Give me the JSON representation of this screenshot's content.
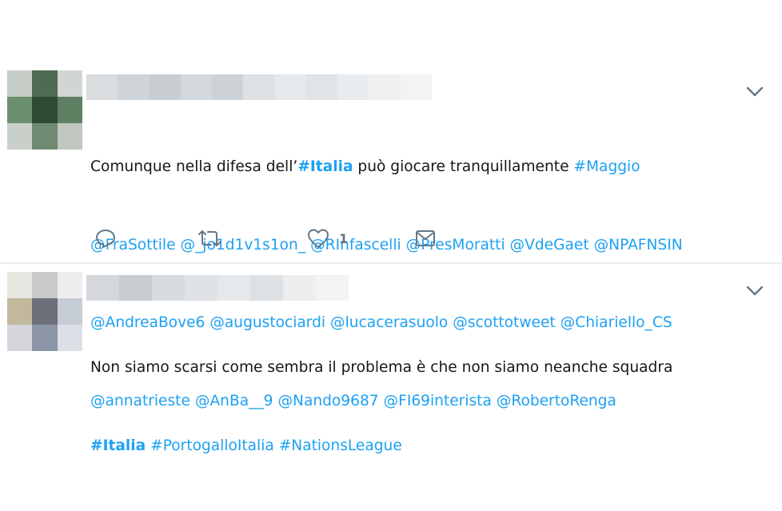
{
  "tweets": [
    {
      "line1_text_a": "Comunque nella difesa dell’",
      "line1_hashtag_a": "#Italia",
      "line1_text_b": " può giocare tranquillamente ",
      "line1_hashtag_b": "#Maggio",
      "line2": [
        "@FraSottile",
        "@_jo1d1v1s1on_",
        "@RInfascelli",
        "@PresMoratti",
        "@VdeGaet",
        "@NPAFNSIN"
      ],
      "line3": [
        "@AndreaBove6",
        "@augustociardi",
        "@lucacerasuolo",
        "@scottotweet",
        "@Chiariello_CS"
      ],
      "line4": [
        "@annatrieste",
        "@AnBa__9",
        "@Nando9687",
        "@FI69interista",
        "@RobertoRenga"
      ],
      "like_count": "1"
    },
    {
      "line1": "Non siamo scarsi come sembra il problema è che non siamo neanche squadra",
      "hashtag_a": "#Italia",
      "hashtag_b": "#PortogalloItalia",
      "hashtag_c": "#NationsLeague"
    }
  ],
  "colors": {
    "link": "#1da1f2",
    "icon": "#657786",
    "divider": "#e6ecf0"
  },
  "icons": [
    "chevron-down-icon",
    "reply-icon",
    "retweet-icon",
    "like-icon",
    "direct-message-icon"
  ]
}
